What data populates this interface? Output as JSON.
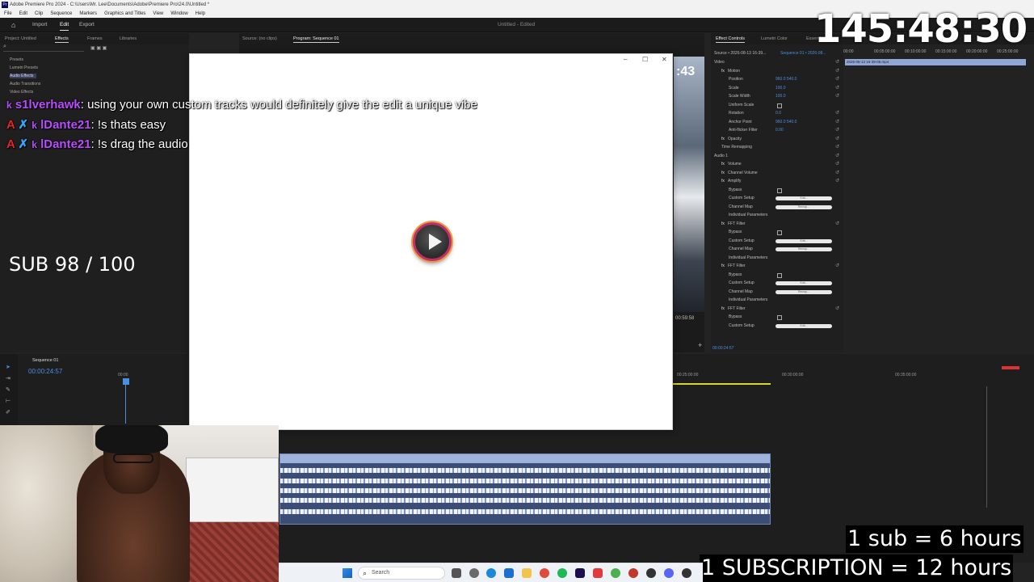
{
  "window": {
    "title": "Adobe Premiere Pro 2024 - C:\\Users\\Mr. Lee\\Documents\\Adobe\\Premiere Pro\\24.0\\Untitled *",
    "menu": [
      "File",
      "Edit",
      "Clip",
      "Sequence",
      "Markers",
      "Graphics and Titles",
      "View",
      "Window",
      "Help"
    ]
  },
  "app_header": {
    "tabs": [
      "Import",
      "Edit",
      "Export"
    ],
    "active_tab": "Edit",
    "doc_title": "Untitled",
    "doc_status": "- Edited"
  },
  "left_panel": {
    "tabs": [
      "Project: Untitled",
      "Effects",
      "Frames",
      "Libraries"
    ],
    "tree": [
      "Presets",
      "Lumetri Presets",
      "Audio Effects",
      "Audio Transitions",
      "Video Effects"
    ],
    "selected": "Audio Effects"
  },
  "source_monitor": {
    "tabs": [
      "Source: (no clips)",
      "Program: Sequence 01"
    ],
    "time_fragment": ":43",
    "timecode": "00:59:58"
  },
  "effect_controls": {
    "tabs": [
      "Effect Controls",
      "Lumetri Color",
      "Essenti"
    ],
    "source": "Source • 2026-08-13 16-39...",
    "sequence": "Sequence 01 • 2026-08...",
    "clip_label": "2026-08-13 16-39-06.mp4",
    "ruler": [
      "00:00",
      "00:05:00:00",
      "00:10:00:00",
      "00:15:00:00",
      "00:20:00:00",
      "00:25:00:00"
    ],
    "rows": [
      {
        "name": "Video",
        "indent": 0
      },
      {
        "name": "Motion",
        "indent": 1,
        "fx": true
      },
      {
        "name": "Position",
        "indent": 2,
        "value": "960.0     540.0"
      },
      {
        "name": "Scale",
        "indent": 2,
        "value": "100.0"
      },
      {
        "name": "Scale Width",
        "indent": 2,
        "value": "100.0"
      },
      {
        "name": "Uniform Scale",
        "indent": 2,
        "checkbox": true
      },
      {
        "name": "Rotation",
        "indent": 2,
        "value": "0.0"
      },
      {
        "name": "Anchor Point",
        "indent": 2,
        "value": "960.0     540.0"
      },
      {
        "name": "Anti-flicker Filter",
        "indent": 2,
        "value": "0.00"
      },
      {
        "name": "Opacity",
        "indent": 1,
        "fx": true
      },
      {
        "name": "Time Remapping",
        "indent": 1
      },
      {
        "name": "Audio 1",
        "indent": 0
      },
      {
        "name": "Volume",
        "indent": 1,
        "fx": true
      },
      {
        "name": "Channel Volume",
        "indent": 1,
        "fx": true
      },
      {
        "name": "Amplify",
        "indent": 1,
        "fx": true
      },
      {
        "name": "Bypass",
        "indent": 2,
        "checkbox": true
      },
      {
        "name": "Custom Setup",
        "indent": 2,
        "button": "Edit..."
      },
      {
        "name": "Channel Map",
        "indent": 2,
        "button": "Remap..."
      },
      {
        "name": "Individual Parameters",
        "indent": 2
      },
      {
        "name": "FFT Filter",
        "indent": 1,
        "fx": true
      },
      {
        "name": "Bypass",
        "indent": 2,
        "checkbox": true
      },
      {
        "name": "Custom Setup",
        "indent": 2,
        "button": "Edit..."
      },
      {
        "name": "Channel Map",
        "indent": 2,
        "button": "Remap..."
      },
      {
        "name": "Individual Parameters",
        "indent": 2
      },
      {
        "name": "FFT Filter",
        "indent": 1,
        "fx": true
      },
      {
        "name": "Bypass",
        "indent": 2,
        "checkbox": true
      },
      {
        "name": "Custom Setup",
        "indent": 2,
        "button": "Edit..."
      },
      {
        "name": "Channel Map",
        "indent": 2,
        "button": "Remap..."
      },
      {
        "name": "Individual Parameters",
        "indent": 2
      },
      {
        "name": "FFT Filter",
        "indent": 1,
        "fx": true
      },
      {
        "name": "Bypass",
        "indent": 2,
        "checkbox": true
      },
      {
        "name": "Custom Setup",
        "indent": 2,
        "button": "Edit..."
      }
    ],
    "footer_time": "00:00:24:57"
  },
  "timeline": {
    "tab": "Sequence 01",
    "playhead_time": "00:00:24:57",
    "ruler_left": "00:00",
    "ruler_right": [
      "00:25:00:00",
      "00:30:00:00",
      "00:35:00:00"
    ]
  },
  "dialog": {
    "controls": [
      "–",
      "☐",
      "✕"
    ]
  },
  "overlay": {
    "timer": "145:48:30",
    "chat": [
      {
        "user": "s1lverhawk",
        "badges": [
          "k"
        ],
        "message": ": using your own custom tracks would definitely give the edit a unique vibe"
      },
      {
        "user": "lDante21",
        "badges": [
          "A",
          "✗",
          "k"
        ],
        "message": ": !s thats easy"
      },
      {
        "user": "lDante21",
        "badges": [
          "A",
          "✗",
          "k"
        ],
        "message": ": !s drag the audio"
      }
    ],
    "sub_goal": "SUB 98 / 100",
    "rule1": "1 sub = 6 hours",
    "rule2": "1 SUBSCRIPTION = 12 hours"
  },
  "taskbar": {
    "search_placeholder": "Search"
  }
}
